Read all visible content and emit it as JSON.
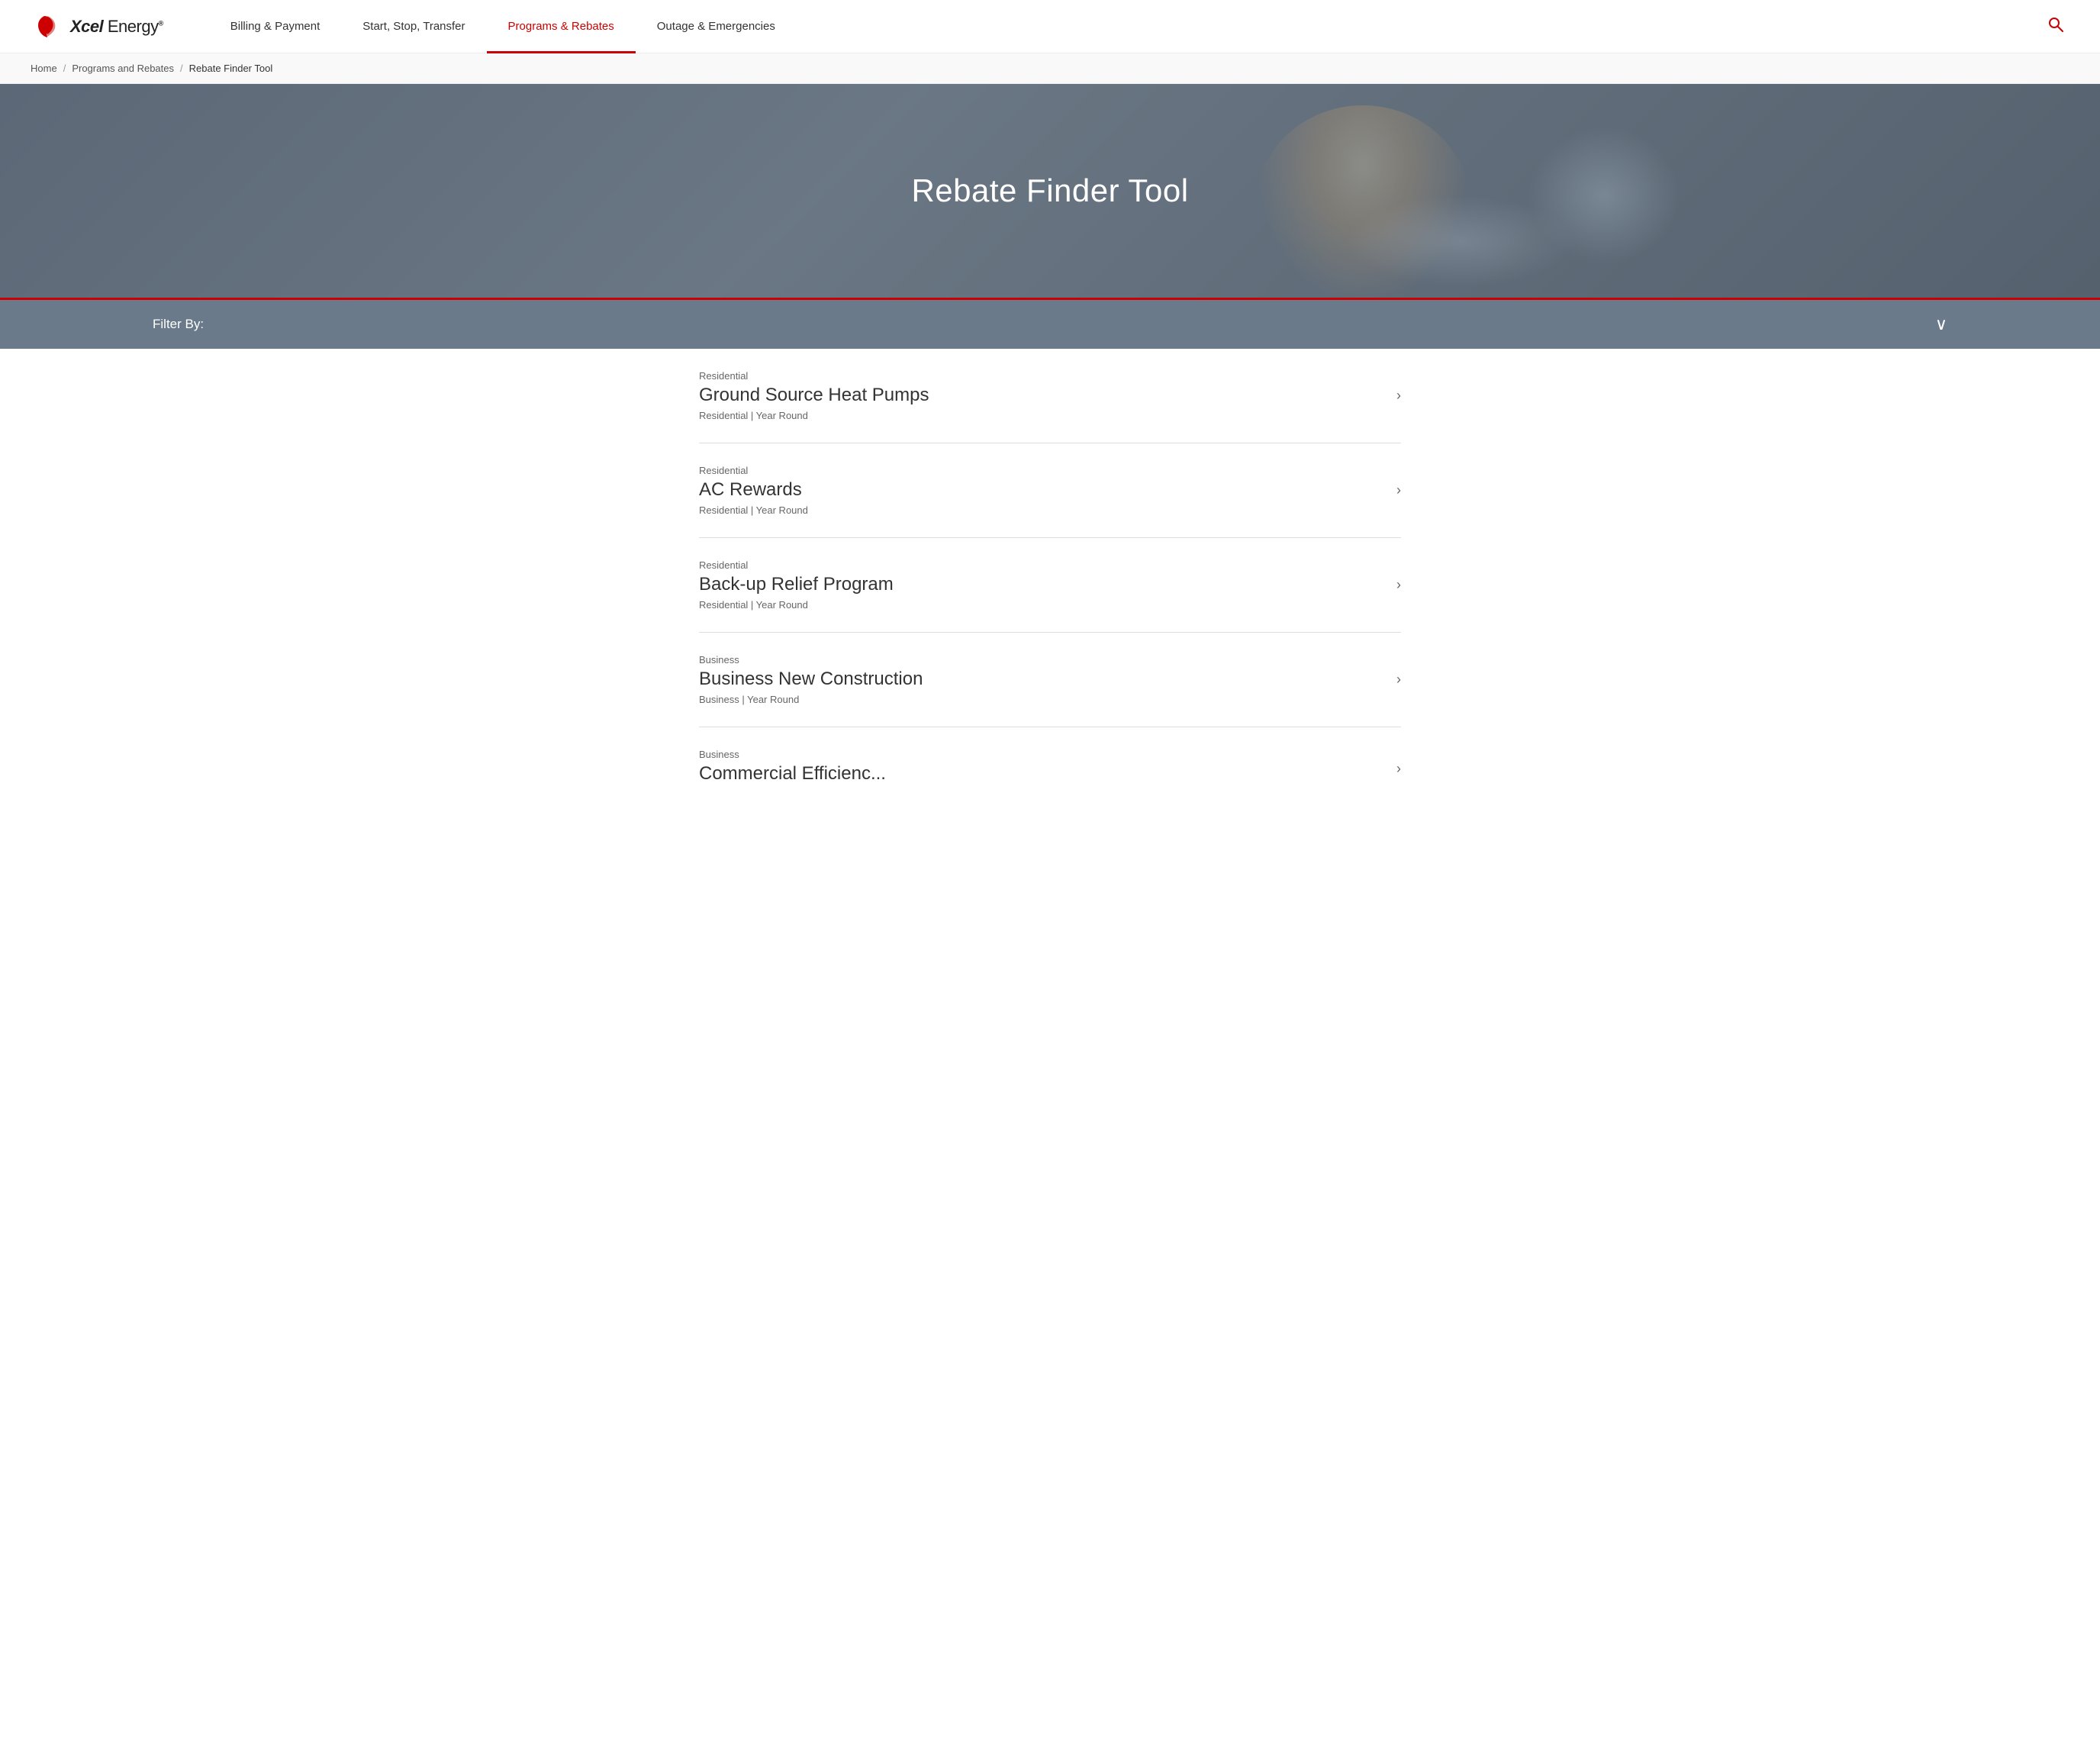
{
  "header": {
    "logo_text": "Xcel Energy",
    "logo_text_plain": "Xcel ",
    "logo_text_bold": "Energy",
    "nav_items": [
      {
        "label": "Billing & Payment",
        "active": false,
        "id": "billing"
      },
      {
        "label": "Start, Stop, Transfer",
        "active": false,
        "id": "start-stop"
      },
      {
        "label": "Programs & Rebates",
        "active": true,
        "id": "programs"
      },
      {
        "label": "Outage & Emergencies",
        "active": false,
        "id": "outage"
      }
    ],
    "search_icon": "🔍"
  },
  "breadcrumb": {
    "items": [
      {
        "label": "Home",
        "current": false
      },
      {
        "label": "Programs and Rebates",
        "current": false
      },
      {
        "label": "Rebate Finder Tool",
        "current": true
      }
    ]
  },
  "hero": {
    "title": "Rebate Finder Tool"
  },
  "filter_bar": {
    "label": "Filter By:",
    "chevron": "∨"
  },
  "results": [
    {
      "category": "Residential",
      "title": "Ground Source Heat Pumps",
      "meta": "Residential | Year Round"
    },
    {
      "category": "Residential",
      "title": "AC Rewards",
      "meta": "Residential | Year Round"
    },
    {
      "category": "Residential",
      "title": "Back-up Relief Program",
      "meta": "Residential | Year Round"
    },
    {
      "category": "Business",
      "title": "Business New Construction",
      "meta": "Business | Year Round"
    },
    {
      "category": "Business",
      "title": "Commercial Efficienc...",
      "meta": ""
    }
  ],
  "colors": {
    "brand_red": "#cc0000",
    "nav_active": "#cc0000",
    "hero_bg": "#6b7a8a",
    "filter_bg": "#6b7a8a"
  }
}
